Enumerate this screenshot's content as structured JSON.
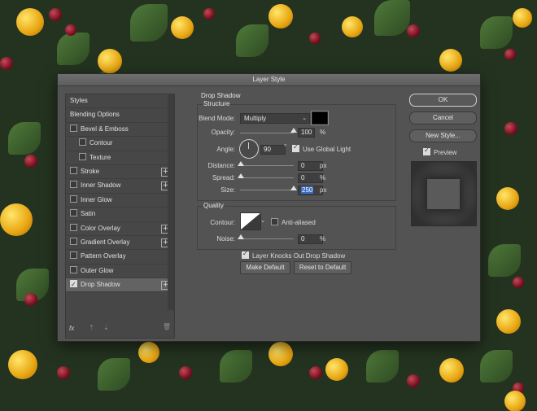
{
  "dialog": {
    "title": "Layer Style"
  },
  "styles_list": [
    {
      "label": "Styles",
      "checkbox": false,
      "indent": false,
      "plus": false,
      "selected": false
    },
    {
      "label": "Blending Options",
      "checkbox": false,
      "indent": false,
      "plus": false,
      "selected": false
    },
    {
      "label": "Bevel & Emboss",
      "checkbox": true,
      "checked": false,
      "indent": false,
      "plus": false,
      "selected": false
    },
    {
      "label": "Contour",
      "checkbox": true,
      "checked": false,
      "indent": true,
      "plus": false,
      "selected": false
    },
    {
      "label": "Texture",
      "checkbox": true,
      "checked": false,
      "indent": true,
      "plus": false,
      "selected": false
    },
    {
      "label": "Stroke",
      "checkbox": true,
      "checked": false,
      "indent": false,
      "plus": true,
      "selected": false
    },
    {
      "label": "Inner Shadow",
      "checkbox": true,
      "checked": false,
      "indent": false,
      "plus": true,
      "selected": false
    },
    {
      "label": "Inner Glow",
      "checkbox": true,
      "checked": false,
      "indent": false,
      "plus": false,
      "selected": false
    },
    {
      "label": "Satin",
      "checkbox": true,
      "checked": false,
      "indent": false,
      "plus": false,
      "selected": false
    },
    {
      "label": "Color Overlay",
      "checkbox": true,
      "checked": false,
      "indent": false,
      "plus": true,
      "selected": false
    },
    {
      "label": "Gradient Overlay",
      "checkbox": true,
      "checked": false,
      "indent": false,
      "plus": true,
      "selected": false
    },
    {
      "label": "Pattern Overlay",
      "checkbox": true,
      "checked": false,
      "indent": false,
      "plus": false,
      "selected": false
    },
    {
      "label": "Outer Glow",
      "checkbox": true,
      "checked": false,
      "indent": false,
      "plus": false,
      "selected": false
    },
    {
      "label": "Drop Shadow",
      "checkbox": true,
      "checked": true,
      "indent": false,
      "plus": true,
      "selected": true
    }
  ],
  "left_footer": {
    "fx": "fx",
    "up": "⇡",
    "down": "⇣",
    "trash": "🗑"
  },
  "panel": {
    "title": "Drop Shadow",
    "structure": {
      "label": "Structure",
      "blend_mode_label": "Blend Mode:",
      "blend_mode_value": "Multiply",
      "shadow_color": "#000000",
      "opacity_label": "Opacity:",
      "opacity_value": "100",
      "opacity_level": 1.0,
      "percent": "%",
      "angle_label": "Angle:",
      "angle_value": "90",
      "degree": "°",
      "use_global_light_label": "Use Global Light",
      "use_global_light_checked": true,
      "distance_label": "Distance:",
      "distance_value": "0",
      "px": "px",
      "spread_label": "Spread:",
      "spread_value": "0",
      "size_label": "Size:",
      "size_value": "250",
      "size_level": 1.0
    },
    "quality": {
      "label": "Quality",
      "contour_label": "Contour:",
      "anti_aliased_label": "Anti-aliased",
      "anti_aliased_checked": false,
      "noise_label": "Noise:",
      "noise_value": "0"
    },
    "layer_knocks_label": "Layer Knocks Out Drop Shadow",
    "layer_knocks_checked": true,
    "make_default_label": "Make Default",
    "reset_default_label": "Reset to Default"
  },
  "right": {
    "ok_label": "OK",
    "cancel_label": "Cancel",
    "new_style_label": "New Style...",
    "preview_label": "Preview",
    "preview_checked": true
  },
  "colors": {
    "accent": "#3a6ec4",
    "dialog_bg": "#535353"
  }
}
